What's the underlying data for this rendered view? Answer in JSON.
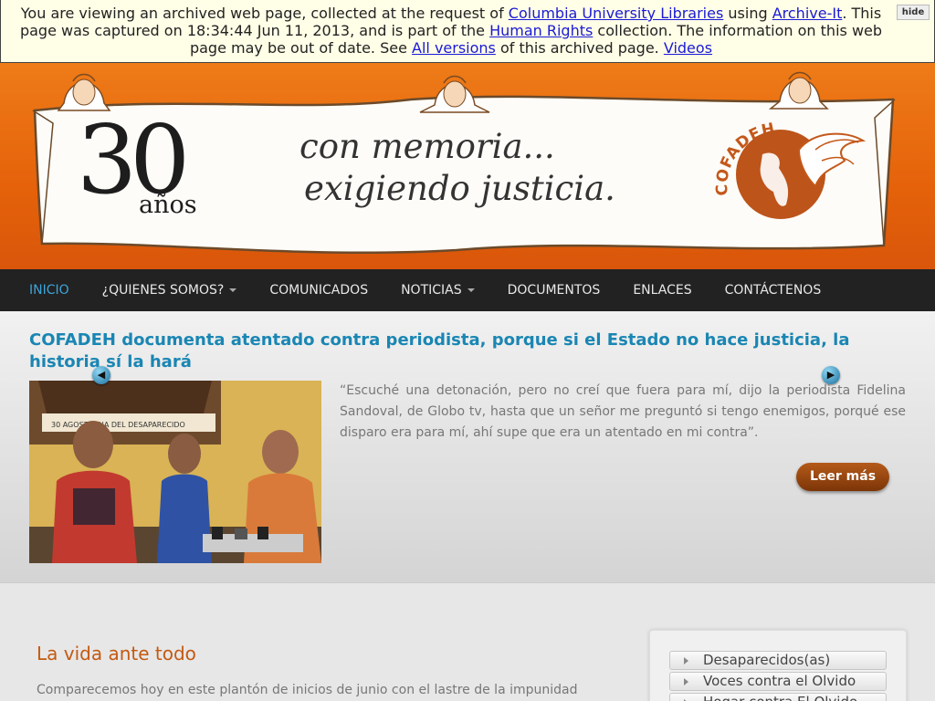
{
  "archive_banner": {
    "t1": "You are viewing an archived web page, collected at the request of ",
    "link_columbia": "Columbia University Libraries",
    "t2": " using ",
    "link_archiveit": "Archive-It",
    "t3": ". This page was captured on 18:34:44 Jun 11, 2013, and is part of the ",
    "link_hr": "Human Rights",
    "t4": " collection. The information on this web page may be out of date. See ",
    "link_versions": "All versions",
    "t5": " of this archived page. ",
    "link_videos": "Videos",
    "hide_label": "hide"
  },
  "header": {
    "number": "30",
    "years": "años",
    "slogan_line1": "con memoria...",
    "slogan_line2": "exigiendo justicia.",
    "logo_text": "COFADEH"
  },
  "nav": {
    "items": [
      {
        "label": "INICIO",
        "active": true
      },
      {
        "label": "¿QUIENES SOMOS?",
        "dropdown": true
      },
      {
        "label": "COMUNICADOS"
      },
      {
        "label": "NOTICIAS",
        "dropdown": true
      },
      {
        "label": "DOCUMENTOS"
      },
      {
        "label": "ENLACES"
      },
      {
        "label": "CONTÁCTENOS"
      }
    ]
  },
  "featured": {
    "title": "COFADEH documenta atentado contra periodista, porque si el Estado no hace justicia, la historia sí la hará",
    "excerpt": "“Escuché una detonación, pero no creí que fuera para mí, dijo la periodista Fidelina Sandoval, de Globo tv,  hasta que un señor me preguntó si tengo enemigos, porqué ese disparo era para mí, ahí supe que era un atentado en mi contra”.",
    "read_more": "Leer más",
    "photo_banner_text": "30 AGOSTO   DIA DEL DESAPARECIDO"
  },
  "main": {
    "title": "La vida ante todo",
    "paragraph": "Comparecemos hoy en este plantón de inicios de junio con el lastre de la impunidad"
  },
  "sidebar": {
    "items": [
      {
        "label": "Desaparecidos(as)"
      },
      {
        "label": "Voces contra el Olvido"
      },
      {
        "label": "Hogar contra El Olvido"
      }
    ]
  },
  "colors": {
    "header_orange": "#e5620a",
    "nav_bg": "#222222",
    "nav_active": "#3ea4d8",
    "title_blue": "#1a86b3",
    "accent_brown": "#c45a12"
  }
}
